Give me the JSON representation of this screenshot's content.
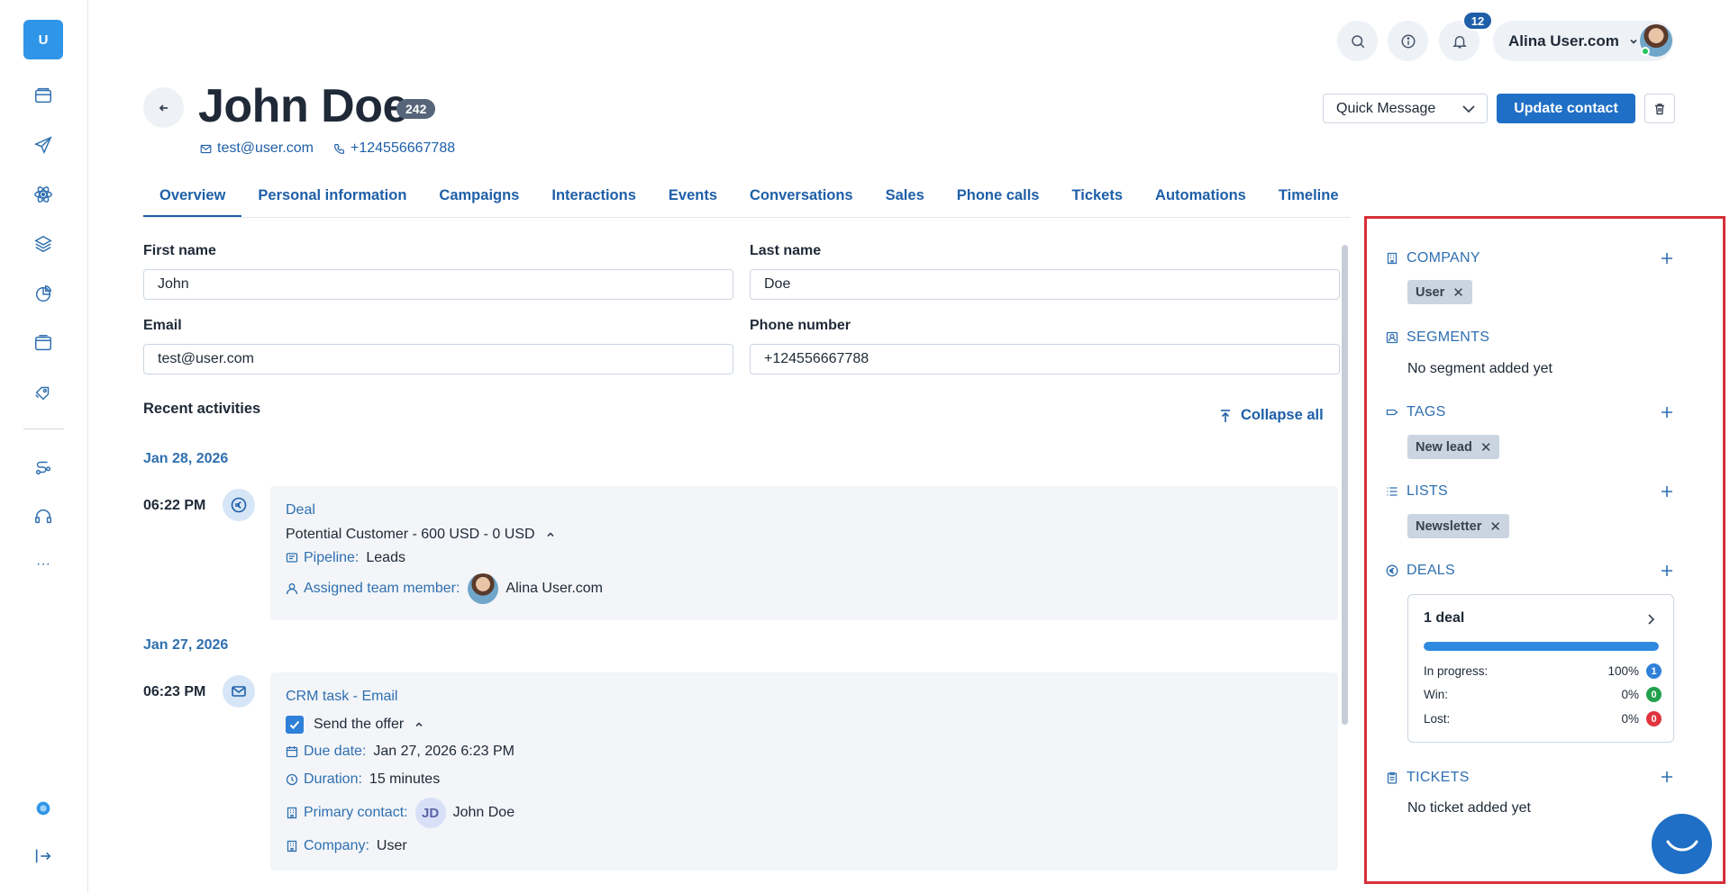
{
  "sidebar": {
    "logo_letter": "U",
    "icons": [
      "folder-icon",
      "send-icon",
      "atom-icon",
      "layers-icon",
      "chart-icon",
      "window-icon",
      "tags-icon",
      "route-icon",
      "headset-icon",
      "more-icon",
      "help-icon",
      "logout-icon"
    ],
    "more_label": "···"
  },
  "header": {
    "notifications_count": "12",
    "user_name": "Alina User.com"
  },
  "contact": {
    "name": "John Doe",
    "id_badge": "242",
    "email": "test@user.com",
    "phone": "+124556667788"
  },
  "actions": {
    "quick_message": "Quick Message",
    "update": "Update contact"
  },
  "tabs": [
    "Overview",
    "Personal information",
    "Campaigns",
    "Interactions",
    "Events",
    "Conversations",
    "Sales",
    "Phone calls",
    "Tickets",
    "Automations",
    "Timeline"
  ],
  "form": {
    "first_name_label": "First name",
    "first_name_value": "John",
    "last_name_label": "Last name",
    "last_name_value": "Doe",
    "email_label": "Email",
    "email_value": "test@user.com",
    "phone_label": "Phone number",
    "phone_value": "+124556667788"
  },
  "activities": {
    "title": "Recent activities",
    "collapse_all": "Collapse all",
    "groups": [
      {
        "date": "Jan 28, 2026",
        "time": "06:22 PM",
        "type": "Deal",
        "summary": "Potential Customer - 600 USD - 0 USD",
        "pipeline_label": "Pipeline:",
        "pipeline_value": "Leads",
        "assigned_label": "Assigned team member:",
        "assigned_value": "Alina User.com"
      },
      {
        "date": "Jan 27, 2026",
        "time": "06:23 PM",
        "type": "CRM task - Email",
        "task": "Send the offer",
        "due_label": "Due date:",
        "due_value": "Jan 27, 2026 6:23 PM",
        "duration_label": "Duration:",
        "duration_value": "15 minutes",
        "primary_label": "Primary contact:",
        "primary_initials": "JD",
        "primary_value": "John Doe",
        "company_label": "Company:",
        "company_value": "User"
      }
    ]
  },
  "right_panel": {
    "company": {
      "title": "COMPANY",
      "chips": [
        "User"
      ]
    },
    "segments": {
      "title": "SEGMENTS",
      "empty": "No segment added yet"
    },
    "tags": {
      "title": "TAGS",
      "chips": [
        "New lead"
      ]
    },
    "lists": {
      "title": "LISTS",
      "chips": [
        "Newsletter"
      ]
    },
    "deals": {
      "title": "DEALS",
      "summary": "1 deal",
      "progress_fraction": 1.0,
      "rows": [
        {
          "label": "In progress:",
          "pct": "100%",
          "count": "1",
          "color": "#2f80d8"
        },
        {
          "label": "Win:",
          "pct": "0%",
          "count": "0",
          "color": "#22a04b"
        },
        {
          "label": "Lost:",
          "pct": "0%",
          "count": "0",
          "color": "#e0343e"
        }
      ]
    },
    "tickets": {
      "title": "TICKETS",
      "empty": "No ticket added yet"
    }
  },
  "colors": {
    "accent": "#1e6fc5",
    "link": "#2f6fb0",
    "highlight_border": "#d6303a"
  }
}
